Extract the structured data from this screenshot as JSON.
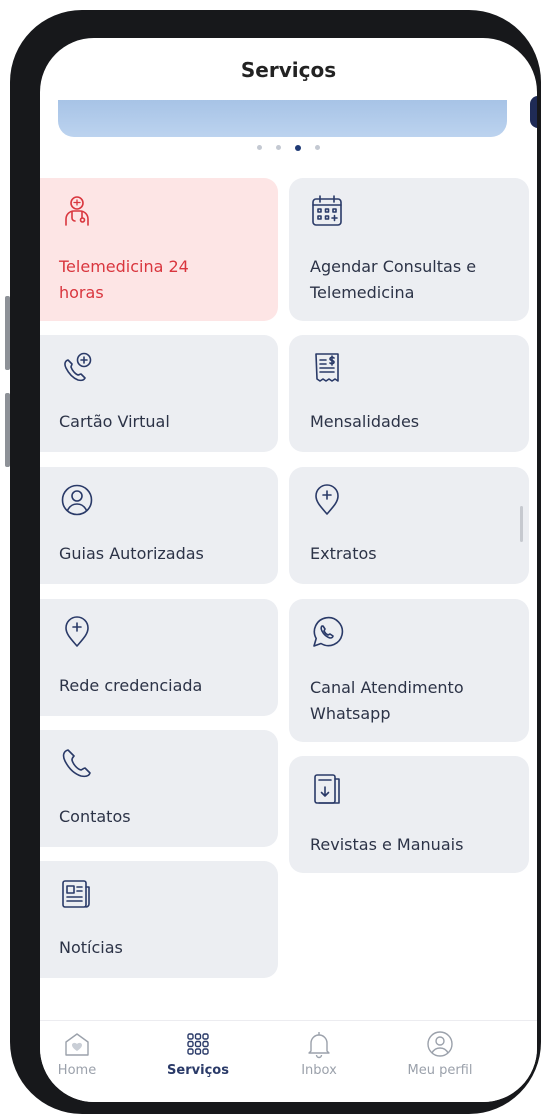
{
  "header": {
    "title": "Serviços"
  },
  "carousel": {
    "dot_count": 4,
    "active_index": 2
  },
  "services": [
    {
      "label": "Telemedicina 24 horas",
      "icon": "doctor-icon",
      "active": true
    },
    {
      "label": "Agendar Consultas e Telemedicina",
      "icon": "calendar-icon",
      "active": false
    },
    {
      "label": "Cartão Virtual",
      "icon": "phone-plus-icon",
      "active": false
    },
    {
      "label": "Mensalidades",
      "icon": "receipt-dollar-icon",
      "active": false
    },
    {
      "label": "Guias Autorizadas",
      "icon": "user-circle-icon",
      "active": false
    },
    {
      "label": "Extratos",
      "icon": "location-plus-icon",
      "active": false
    },
    {
      "label": "Rede credenciada",
      "icon": "location-plus-icon",
      "active": false
    },
    {
      "label": "Canal Atendimento Whatsapp",
      "icon": "whatsapp-icon",
      "active": false
    },
    {
      "label": "Contatos",
      "icon": "phone-icon",
      "active": false
    },
    {
      "label": "Revistas e Manuais",
      "icon": "book-download-icon",
      "active": false
    },
    {
      "label": "Notícias",
      "icon": "newspaper-icon",
      "active": false
    }
  ],
  "tabbar": {
    "tabs": [
      {
        "label": "Home",
        "icon": "home-heart-icon",
        "selected": false
      },
      {
        "label": "Serviços",
        "icon": "grid-dots-icon",
        "selected": true
      },
      {
        "label": "Inbox",
        "icon": "bell-icon",
        "selected": false
      },
      {
        "label": "Meu perfil",
        "icon": "user-circle-icon",
        "selected": false
      }
    ]
  },
  "colors": {
    "accent_red": "#d9363e",
    "navy": "#2a3a68",
    "card_bg": "#eceef2",
    "active_card_bg": "#fde5e5"
  }
}
